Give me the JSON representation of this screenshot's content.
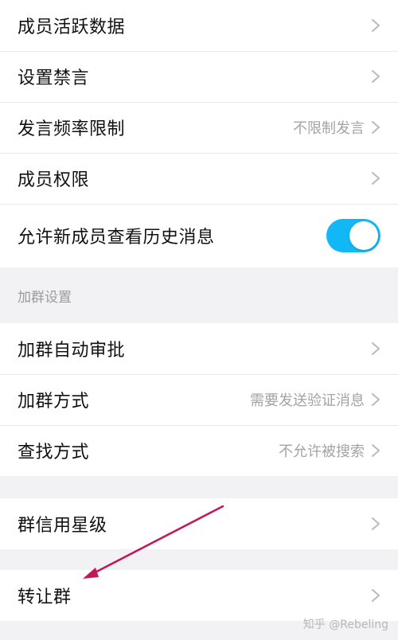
{
  "group1": {
    "items": [
      {
        "label": "成员活跃数据",
        "value": ""
      },
      {
        "label": "设置禁言",
        "value": ""
      },
      {
        "label": "发言频率限制",
        "value": "不限制发言"
      },
      {
        "label": "成员权限",
        "value": ""
      }
    ],
    "history_toggle": {
      "label": "允许新成员查看历史消息",
      "on": true,
      "color": "#12b7f5"
    }
  },
  "join_section": {
    "header": "加群设置",
    "items": [
      {
        "label": "加群自动审批",
        "value": ""
      },
      {
        "label": "加群方式",
        "value": "需要发送验证消息"
      },
      {
        "label": "查找方式",
        "value": "不允许被搜索"
      }
    ]
  },
  "credit": {
    "label": "群信用星级"
  },
  "transfer": {
    "label": "转让群"
  },
  "annotation": {
    "arrow_color": "#c2185b"
  },
  "watermark": "知乎 @Rebeling"
}
